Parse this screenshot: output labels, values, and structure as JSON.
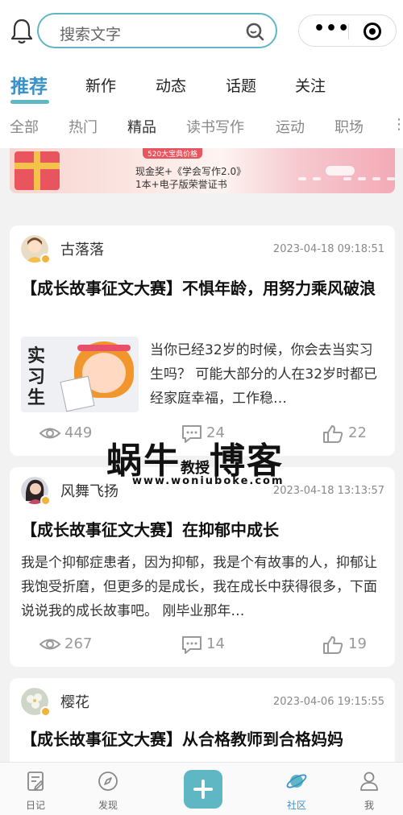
{
  "search": {
    "placeholder": "搜索文字"
  },
  "capsule": {
    "more_icon": "more-dots-icon",
    "close_icon": "target-icon",
    "more_text": "•••"
  },
  "main_tabs": [
    "推荐",
    "新作",
    "动态",
    "话题",
    "关注"
  ],
  "sub_tabs": [
    "全部",
    "热门",
    "精品",
    "读书写作",
    "运动",
    "职场"
  ],
  "banner": {
    "top_text": "520大宝典价格",
    "line1": "现金奖+《学会写作2.0》",
    "line2": "1本+电子版荣誉证书"
  },
  "posts": [
    {
      "user": "古落落",
      "time": "2023-04-18 09:18:51",
      "title": "【成长故事征文大赛】不惧年龄，用努力乘风破浪",
      "thumb_text": "实习生",
      "excerpt": "当你已经32岁的时候，你会去当实习生吗？ 可能大部分的人在32岁时都已经家庭幸福，工作稳…",
      "views": "449",
      "comments": "24",
      "likes": "22"
    },
    {
      "user": "风舞飞扬",
      "time": "2023-04-18 13:13:57",
      "title": "【成长故事征文大赛】在抑郁中成长",
      "excerpt": "我是个抑郁症患者，因为抑郁，我是个有故事的人，抑郁让我饱受折磨，但更多的是成长，我在成长中获得很多，下面说说我的成长故事吧。 刚毕业那年…",
      "views": "267",
      "comments": "14",
      "likes": "19"
    },
    {
      "user": "樱花",
      "time": "2023-04-06 19:15:55",
      "title": "【成长故事征文大赛】从合格教师到合格妈妈"
    }
  ],
  "watermark": {
    "big": "蜗牛",
    "mid": "教授",
    "big2": "博客",
    "url": "www.woniuboke.com"
  },
  "bottom_nav": [
    {
      "label": "日记",
      "icon": "diary-icon"
    },
    {
      "label": "发现",
      "icon": "compass-icon"
    },
    {
      "label": "社区",
      "icon": "planet-icon"
    },
    {
      "label": "我",
      "icon": "person-icon"
    }
  ],
  "colors": {
    "accent": "#5fb7c4",
    "active_text": "#3b92c9",
    "muted": "#999999"
  }
}
